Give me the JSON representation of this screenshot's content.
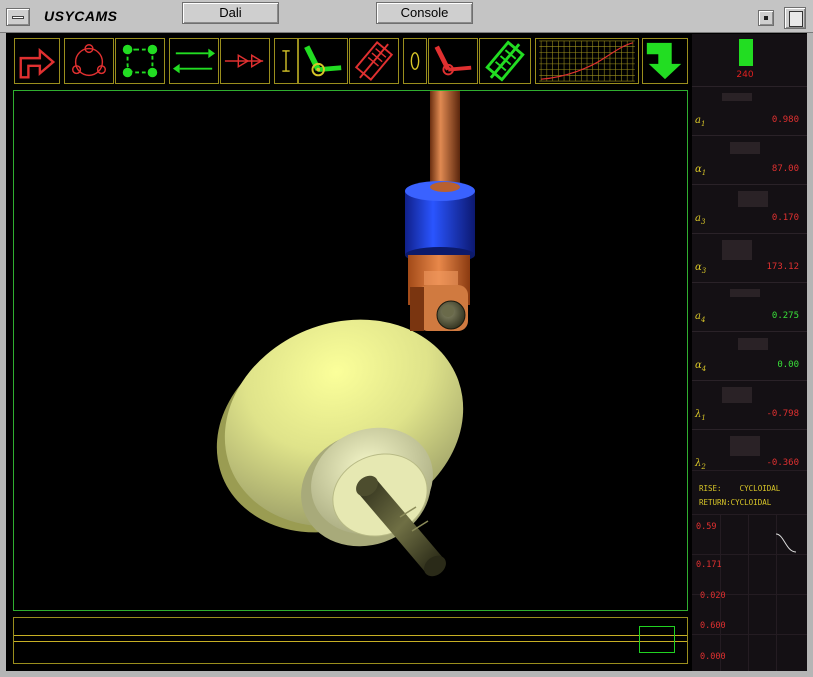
{
  "window": {
    "title": "USYCAMS",
    "tabs": [
      {
        "label": "Dali"
      },
      {
        "label": "Console"
      }
    ]
  },
  "toolbar": {
    "tools": [
      {
        "icon": "turn-arrow-icon"
      },
      {
        "icon": "cam-profile-icon"
      },
      {
        "icon": "dwell-nodes-icon"
      },
      {
        "icon": "swap-arrows-icon"
      },
      {
        "icon": "double-arrow-right-icon"
      },
      {
        "icon": "cursor-i-icon"
      },
      {
        "icon": "oscillating-follower-icon"
      },
      {
        "icon": "translating-follower-icon"
      },
      {
        "icon": "ellipse-icon"
      },
      {
        "icon": "roller-arm-icon"
      },
      {
        "icon": "spring-roller-icon"
      },
      {
        "icon": "displacement-plot-icon"
      },
      {
        "icon": "down-arrow-icon"
      }
    ]
  },
  "gauge": {
    "value": "240",
    "level_fraction": 1.0
  },
  "parameters": [
    {
      "symbol": "a",
      "sub": "1",
      "value": "0.980",
      "color": "red"
    },
    {
      "symbol": "α",
      "sub": "1",
      "value": "87.00",
      "color": "red"
    },
    {
      "symbol": "a",
      "sub": "3",
      "value": "0.170",
      "color": "red"
    },
    {
      "symbol": "α",
      "sub": "3",
      "value": "173.12",
      "color": "red"
    },
    {
      "symbol": "a",
      "sub": "4",
      "value": "0.275",
      "color": "green"
    },
    {
      "symbol": "α",
      "sub": "4",
      "value": "0.00",
      "color": "green"
    },
    {
      "symbol": "λ",
      "sub": "1",
      "value": "-0.798",
      "color": "red"
    },
    {
      "symbol": "λ",
      "sub": "2",
      "value": "-0.360",
      "color": "red"
    }
  ],
  "motion_law": {
    "rise": "RISE:    CYCLOIDAL",
    "return": "RETURN:CYCLOIDAL"
  },
  "motion_values": [
    "0.59",
    "0.171",
    "0.020",
    "0.600",
    "0.000"
  ],
  "colors": {
    "accent_green": "#22dd22",
    "accent_red": "#e03030",
    "frame_gold": "#9a8e1d",
    "cam_face": "#e6e888",
    "follower_blue": "#1f3fd6",
    "rod_copper": "#c8703a"
  },
  "timeline": {
    "position_fraction": 0.94
  }
}
